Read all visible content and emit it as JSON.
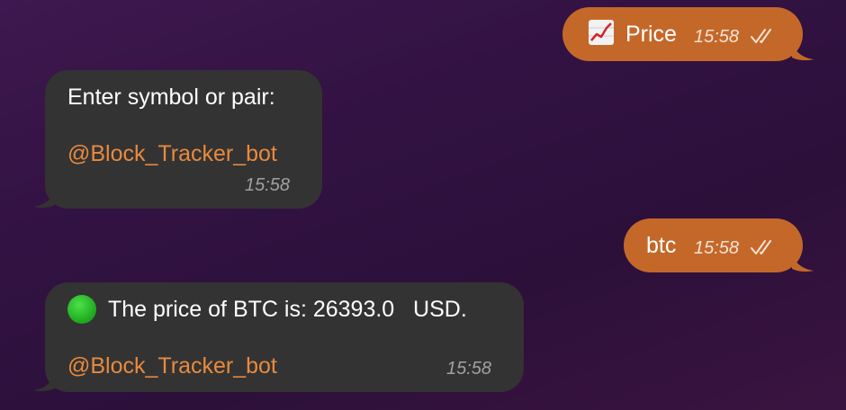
{
  "messages": [
    {
      "direction": "outgoing",
      "icon": "chart-increasing-icon",
      "text": "Price",
      "time": "15:58",
      "status": "read"
    },
    {
      "direction": "incoming",
      "text": "Enter symbol or pair:",
      "mention": "@Block_Tracker_bot",
      "time": "15:58"
    },
    {
      "direction": "outgoing",
      "text": "btc",
      "time": "15:58",
      "status": "read"
    },
    {
      "direction": "incoming",
      "icon": "green-circle-icon",
      "text": "The price of BTC is: 26393.0   USD.",
      "mention": "@Block_Tracker_bot",
      "time": "15:58"
    }
  ],
  "colors": {
    "outgoing_bubble": "#c4682a",
    "incoming_bubble": "#333333",
    "mention": "#e88a3e",
    "background": "#321242"
  }
}
